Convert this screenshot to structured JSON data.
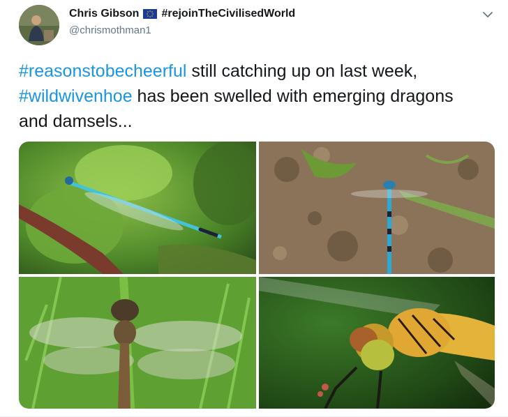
{
  "user": {
    "display_name": "Chris Gibson",
    "flag_icon": "eu-flag-icon",
    "name_hashtag": "#rejoinTheCivilisedWorld",
    "handle": "@chrismothman1"
  },
  "tweet": {
    "hashtag_1": "#reasonstobecheerful",
    "text_1": " still catching up on last week, ",
    "hashtag_2": "#wildwivenhoe",
    "text_2": " has been swelled with emerging dragons and damsels..."
  },
  "media": {
    "photos": [
      {
        "icon": "blue-damselfly-on-leaf-photo"
      },
      {
        "icon": "blue-damselfly-on-ground-photo"
      },
      {
        "icon": "broad-bodied-dragonfly-photo"
      },
      {
        "icon": "darter-dragonfly-closeup-photo"
      }
    ]
  },
  "colors": {
    "hashtag": "#1b95e0",
    "handle": "#657786",
    "text": "#14171a"
  },
  "icons": {
    "more_menu": "chevron-down-icon"
  }
}
